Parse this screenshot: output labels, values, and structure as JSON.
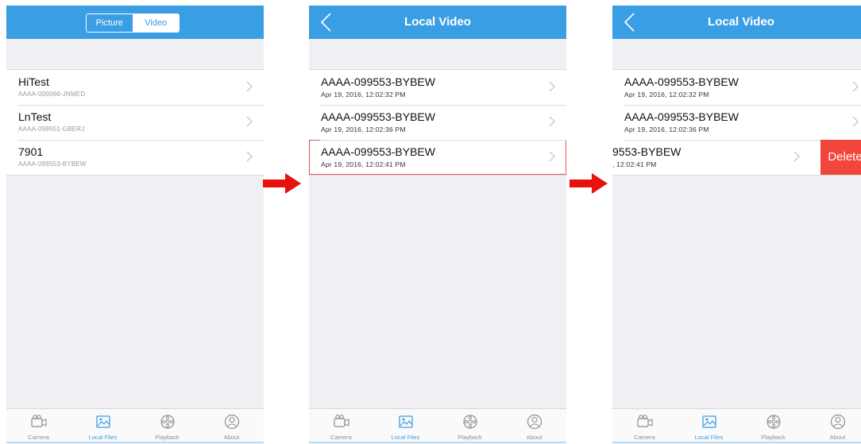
{
  "colors": {
    "accent": "#3a9ee4",
    "background": "#efeff4",
    "delete": "#f2453b",
    "arrow": "#e8120c",
    "selection": "#e05555"
  },
  "tabbar": {
    "tabs": [
      {
        "label": "Camera",
        "icon": "video-camera-icon"
      },
      {
        "label": "Local Files",
        "icon": "image-icon",
        "active": true
      },
      {
        "label": "Playback",
        "icon": "film-reel-icon"
      },
      {
        "label": "About",
        "icon": "person-icon"
      }
    ]
  },
  "screen1": {
    "segment": {
      "picture_label": "Picture",
      "video_label": "Video",
      "selected": "Video"
    },
    "items": [
      {
        "title": "HiTest",
        "subtitle": "AAAA-000066-JNMED"
      },
      {
        "title": "LnTest",
        "subtitle": "AAAA-099551-GBERJ"
      },
      {
        "title": "7901",
        "subtitle": "AAAA-099553-BYBEW"
      }
    ]
  },
  "screen2": {
    "title": "Local Video",
    "items": [
      {
        "title": "AAAA-099553-BYBEW",
        "subtitle": "Apr 19, 2016, 12:02:32 PM"
      },
      {
        "title": "AAAA-099553-BYBEW",
        "subtitle": "Apr 19, 2016, 12:02:36 PM"
      },
      {
        "title": "AAAA-099553-BYBEW",
        "subtitle": "Apr 19, 2016, 12:02:41 PM",
        "selected": true
      }
    ]
  },
  "screen3": {
    "title": "Local Video",
    "items": [
      {
        "title": "AAAA-099553-BYBEW",
        "subtitle": "Apr 19, 2016, 12:02:32 PM"
      },
      {
        "title": "AAAA-099553-BYBEW",
        "subtitle": "Apr 19, 2016, 12:02:36 PM"
      },
      {
        "title": "9553-BYBEW",
        "subtitle": ", 12:02:41 PM",
        "swiped": true
      }
    ],
    "delete_label": "Delete"
  }
}
